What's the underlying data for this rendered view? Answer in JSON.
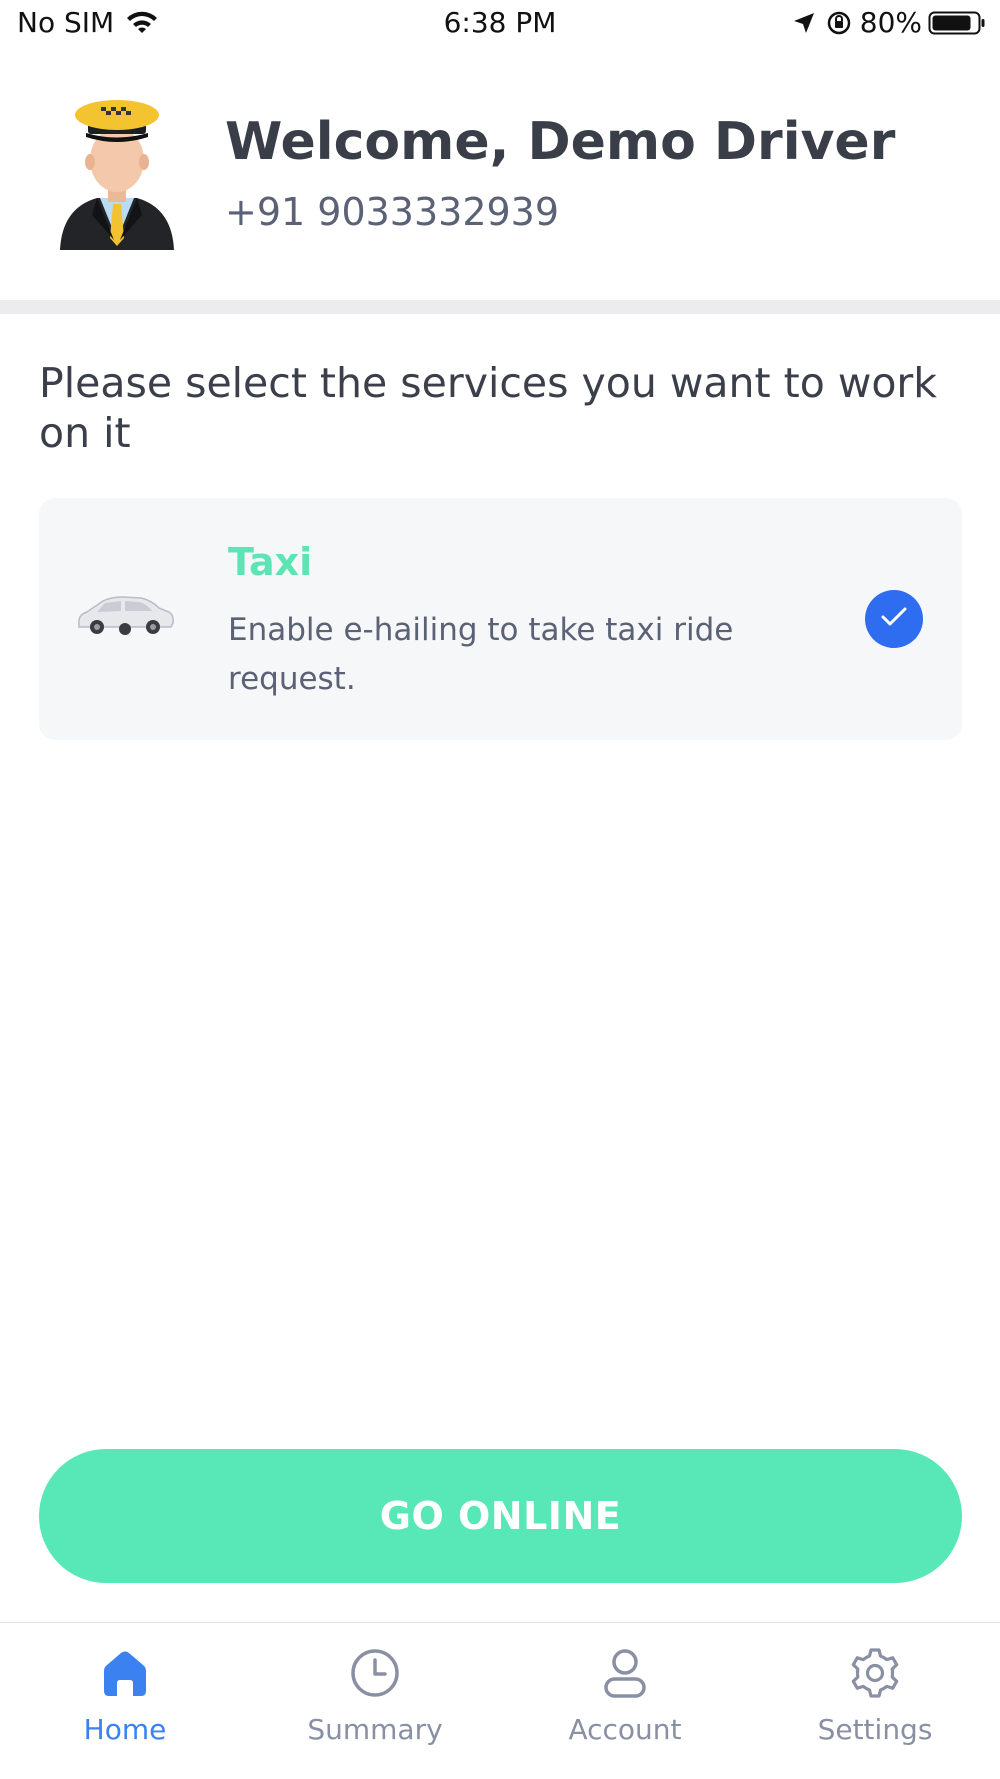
{
  "status_bar": {
    "carrier": "No SIM",
    "time": "6:38 PM",
    "battery": "80%",
    "icons": [
      "wifi-icon",
      "location-arrow-icon",
      "orientation-lock-icon",
      "battery-icon"
    ]
  },
  "header": {
    "welcome": "Welcome, Demo Driver",
    "phone": "+91 9033332939",
    "avatar_icon": "taxi-driver-avatar"
  },
  "prompt": "Please select the services you want to work on it",
  "services": [
    {
      "title": "Taxi",
      "description": "Enable e-hailing to take taxi ride request.",
      "icon": "car-icon",
      "selected": true
    }
  ],
  "go_online_label": "GO ONLINE",
  "nav": {
    "items": [
      {
        "label": "Home",
        "icon": "home-icon",
        "active": true
      },
      {
        "label": "Summary",
        "icon": "clock-icon",
        "active": false
      },
      {
        "label": "Account",
        "icon": "user-icon",
        "active": false
      },
      {
        "label": "Settings",
        "icon": "gear-icon",
        "active": false
      }
    ]
  },
  "colors": {
    "accent_green": "#58e8b8",
    "title_green": "#5ce4b5",
    "check_blue": "#2e6df0",
    "nav_active": "#3b82f0",
    "nav_inactive": "#8a90a3"
  }
}
